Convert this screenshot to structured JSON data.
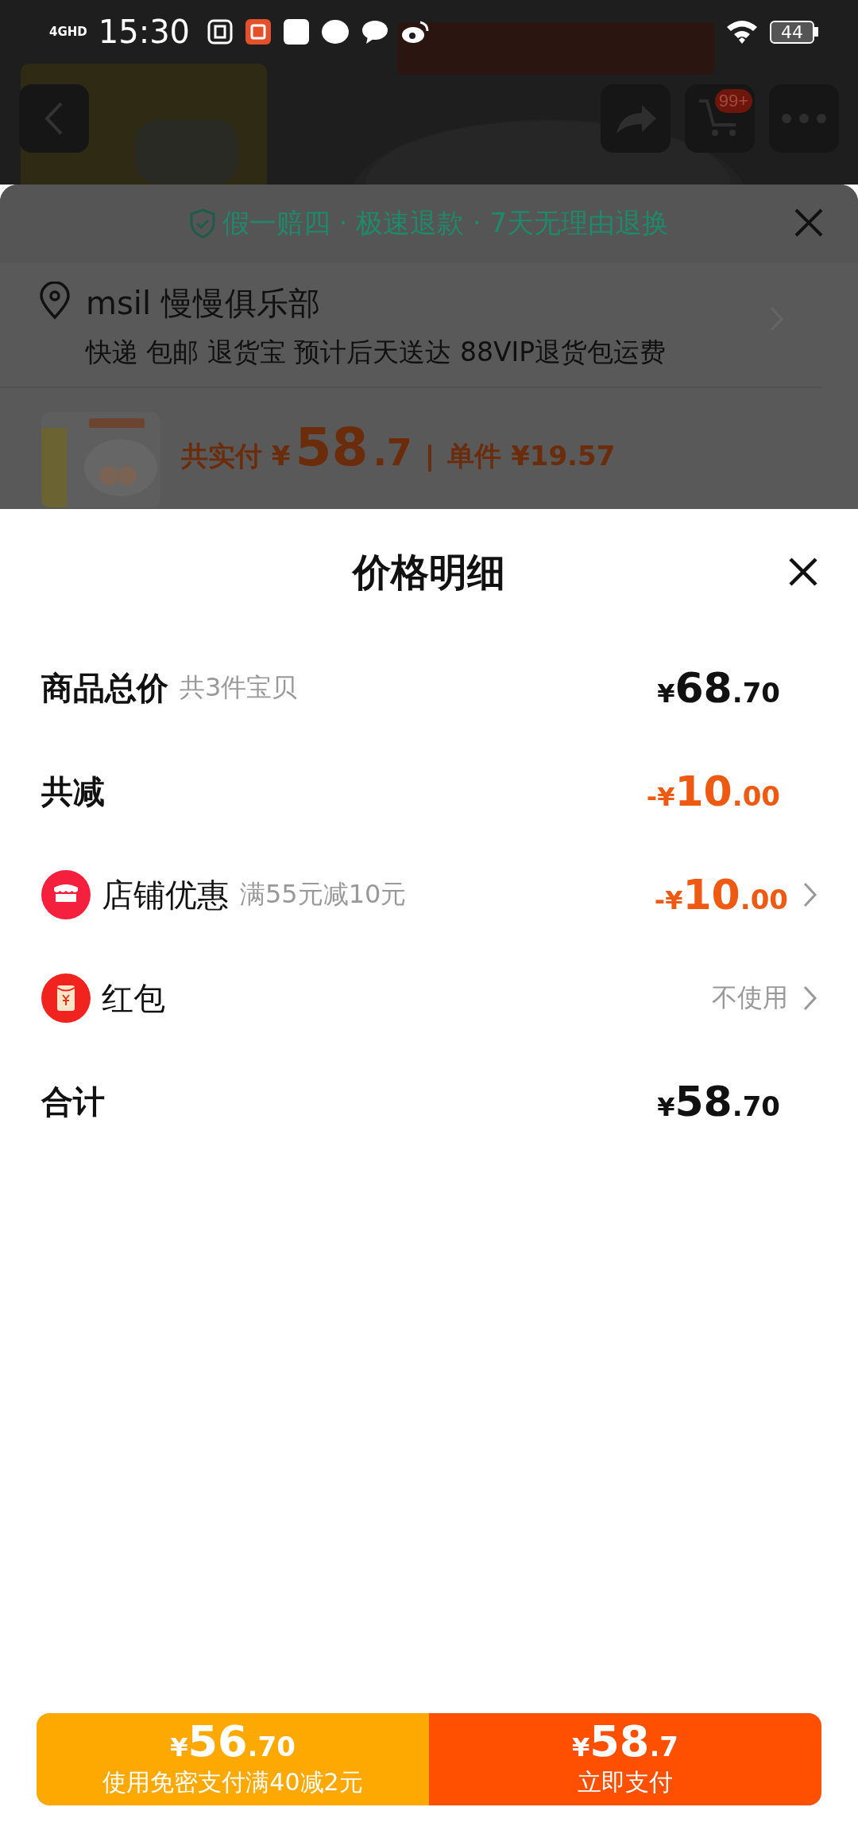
{
  "status_bar": {
    "network": "4GHD",
    "time": "15:30",
    "battery": "44"
  },
  "top_bar": {
    "cart_badge": "99+"
  },
  "service_panel": {
    "guarantee": "假一赔四 · 极速退款 · 7天无理由退换",
    "address": {
      "name": "msil 慢慢俱乐部",
      "details": "快递 包邮 退货宝 预计后天送达 88VIP退货包运费"
    },
    "product": {
      "total_label": "共实付",
      "total_currency": "¥",
      "total_integer": "58",
      "total_fraction": ".7",
      "separator": "|",
      "unit_label": "单件",
      "unit_price": "¥19.57"
    }
  },
  "price_sheet": {
    "title": "价格明细",
    "rows": [
      {
        "kind": "line",
        "label": "商品总价",
        "emphasis": true,
        "note": "共3件宝贝",
        "amount": {
          "currency": "¥",
          "integer": "68",
          "fraction": ".70"
        },
        "highlight": false,
        "chevron": false
      },
      {
        "kind": "line",
        "label": "共减",
        "emphasis": true,
        "amount": {
          "sign": "-",
          "currency": "¥",
          "integer": "10",
          "fraction": ".00"
        },
        "highlight": true,
        "chevron": false
      },
      {
        "kind": "store_discount",
        "label": "店铺优惠",
        "emphasis": false,
        "note": "满55元减10元",
        "amount": {
          "sign": "-",
          "currency": "¥",
          "integer": "10",
          "fraction": ".00"
        },
        "highlight": true,
        "chevron": true
      },
      {
        "kind": "hongbao",
        "label": "红包",
        "emphasis": false,
        "value": "不使用",
        "chevron": true
      },
      {
        "kind": "line",
        "label": "合计",
        "emphasis": true,
        "amount": {
          "currency": "¥",
          "integer": "58",
          "fraction": ".70"
        },
        "highlight": false,
        "chevron": false
      }
    ]
  },
  "actions": [
    {
      "kind": "secondary",
      "currency": "¥",
      "integer": "56",
      "fraction": ".70",
      "label": "使用免密支付满40减2元"
    },
    {
      "kind": "primary",
      "currency": "¥",
      "integer": "58",
      "fraction": ".7",
      "label": "立即支付"
    }
  ]
}
